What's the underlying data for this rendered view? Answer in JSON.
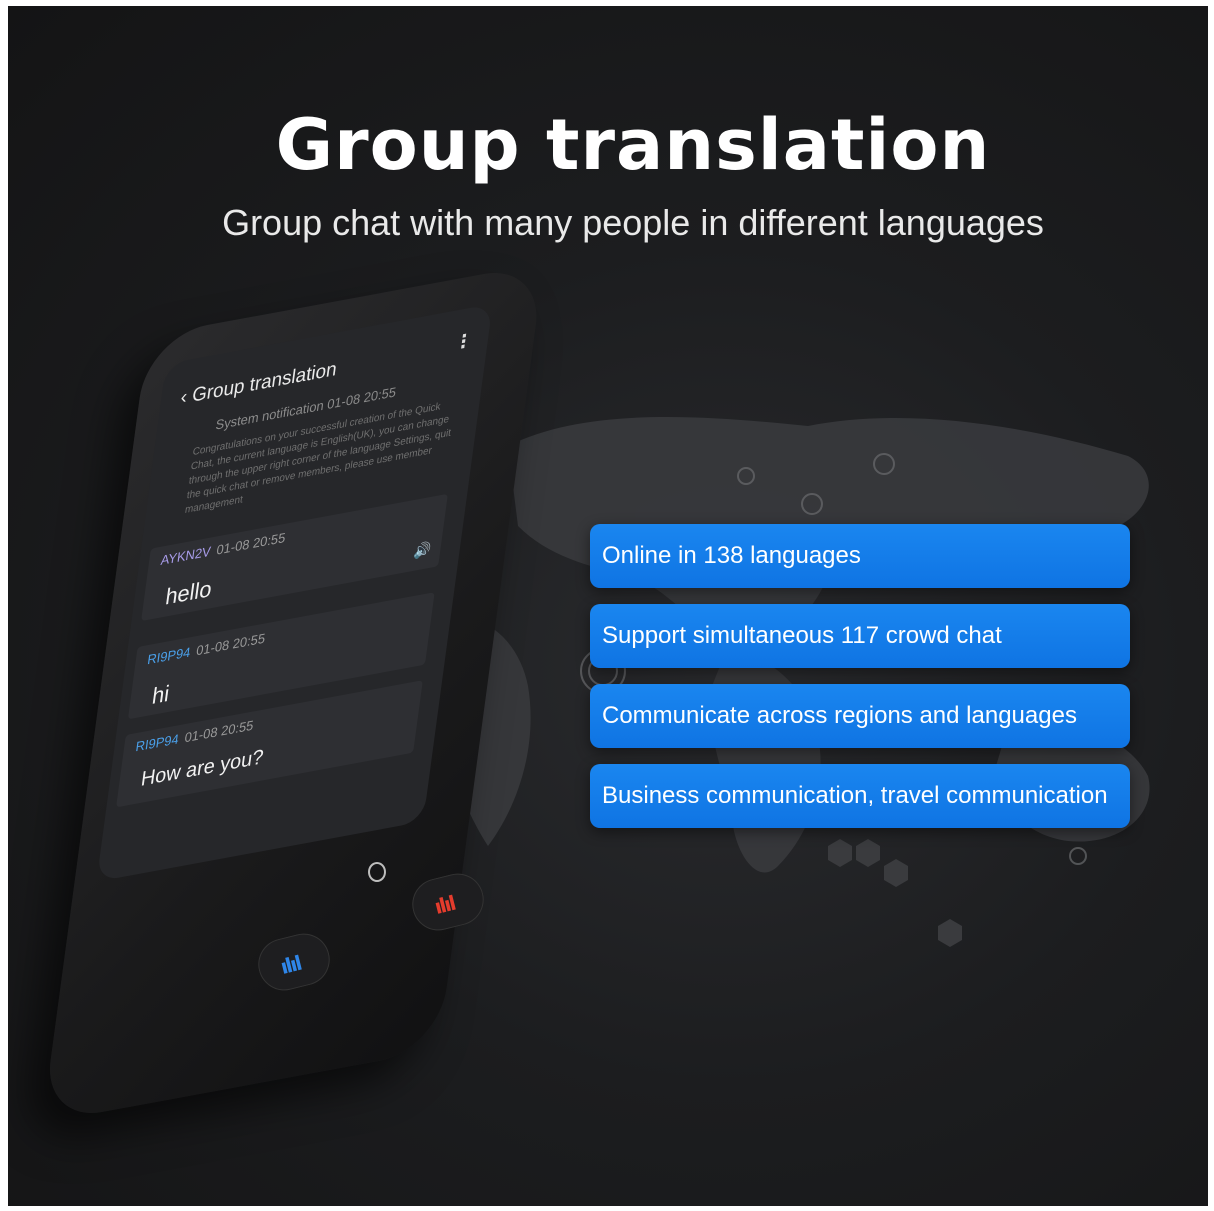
{
  "header": {
    "title": "Group translation",
    "subtitle": "Group chat with many people in different languages"
  },
  "features": [
    "Online in 138 languages",
    "Support simultaneous 117 crowd chat",
    "Communicate across regions and languages",
    "Business communication, travel communication"
  ],
  "device_screen": {
    "title": "Group translation",
    "menu_glyph": "⋮",
    "back_glyph": "‹",
    "system_notification": "System notification 01-08 20:55",
    "system_text": "Congratulations on your successful creation of the Quick Chat, the current language is English(UK), you can change through the upper right corner of the language Settings, quit the quick chat or remove members, please use member management",
    "messages": [
      {
        "user": "AYKN2V",
        "time": "01-08 20:55",
        "text": "hello",
        "speaker": "🔊"
      },
      {
        "user": "RI9P94",
        "time": "01-08 20:55",
        "text": "hi"
      },
      {
        "user": "RI9P94",
        "time": "01-08 20:55",
        "text": "How are you?"
      }
    ]
  },
  "buttons": {
    "left_wave": "ılıl",
    "right_wave": "ılıl"
  },
  "colors": {
    "accent_blue": "#1583ee",
    "left_button_icon": "#2f86e8",
    "right_button_icon": "#e53c2d",
    "user_purple": "#a79be8",
    "user_blue": "#4a9fe8"
  }
}
